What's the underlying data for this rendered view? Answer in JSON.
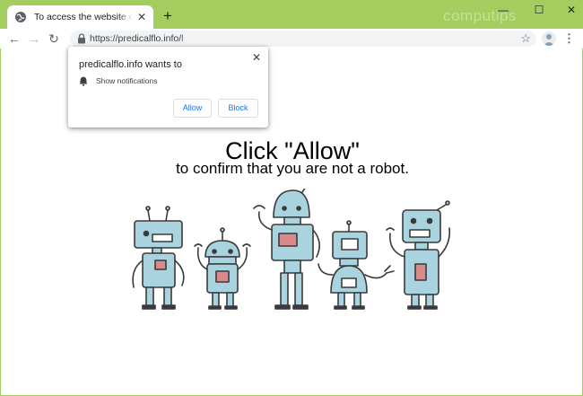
{
  "window": {
    "tab_title": "To access the website click the \"Allow\"",
    "tab_close": "✕",
    "new_tab": "+",
    "watermark": "computips",
    "minimize": "—",
    "maximize": "☐",
    "close": "✕"
  },
  "toolbar": {
    "back": "←",
    "forward": "→",
    "reload": "↻",
    "url": "https://predicalflo.info/",
    "url_cursor": "l",
    "star": "☆",
    "menu": "⋮"
  },
  "popup": {
    "title": "predicalflo.info wants to",
    "close": "✕",
    "permission": "Show notifications",
    "allow_label": "Allow",
    "block_label": "Block"
  },
  "page": {
    "headline": "Click \"Allow\"",
    "subline": "to confirm that you are not a robot."
  },
  "colors": {
    "frame": "#a4cd5f",
    "robot_fill": "#a9d4df",
    "robot_stroke": "#3a3a3a",
    "robot_rose": "#d98b8b",
    "accent": "#1a73e8"
  },
  "icons": [
    "globe-icon",
    "lock-icon",
    "bell-icon",
    "star-icon",
    "avatar-icon"
  ]
}
